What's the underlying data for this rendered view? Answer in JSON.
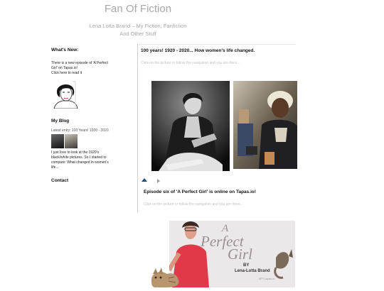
{
  "header": {
    "title": "Fan Of Fiction",
    "subtitle_line1": "Lena Lotta Brand – My Fiction, Fanfiction",
    "subtitle_line2": "And Other Stuff"
  },
  "sidebar": {
    "whats_new": {
      "heading": "What's New:",
      "line1": "There is a new episode of 'A Perfect",
      "line2": "Girl' on Tapas.io!",
      "click": "Click",
      "click_rest": " here to read it"
    },
    "blog": {
      "heading": "My Blog",
      "latest": "Latest entry: 100 Years! 1920 - 2020",
      "text1": "I just love to look at the 1920's",
      "text2": "black/white pictures. So I started to",
      "text3": "compare: What changed in women's",
      "text4": "life..."
    },
    "contact": {
      "heading": "Contact"
    }
  },
  "main": {
    "post1": {
      "title": "100 years! 1920 - 2020... How women's life changed.",
      "hint": "Click on the picture or follow the navigation and you are there..."
    },
    "post2": {
      "title": "Episode six of 'A Perfect Girl' is online on Tapas.io!",
      "hint": "Click on the picture or follow the navigation and you are there..."
    },
    "cover": {
      "line1": "A",
      "line2": "Perfect",
      "line3": "Girl",
      "by": "BY",
      "author": "Lena-Lotta Brand",
      "tag": "#PT tapas.io"
    }
  },
  "colors": {
    "accent": "#1f4d7a",
    "muted_text": "#a8a8a8",
    "hint_text": "#c2c2c2"
  }
}
